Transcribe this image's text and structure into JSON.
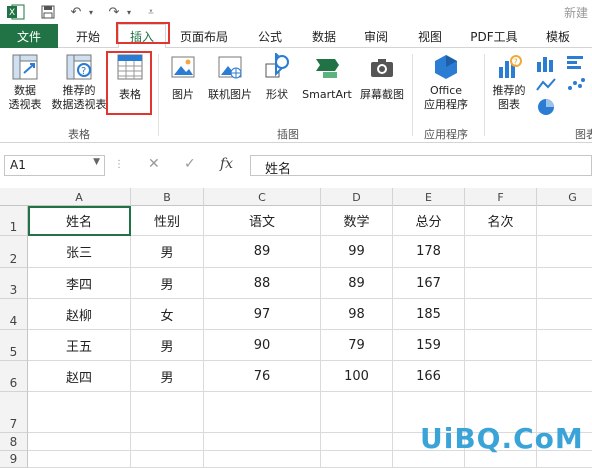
{
  "app": {
    "title_fragment": "新建"
  },
  "tabs": [
    "文件",
    "开始",
    "插入",
    "页面布局",
    "公式",
    "数据",
    "审阅",
    "视图",
    "PDF工具",
    "模板"
  ],
  "ribbon": {
    "buttons": [
      {
        "label1": "数据",
        "label2": "透视表"
      },
      {
        "label1": "推荐的",
        "label2": "数据透视表"
      },
      {
        "label1": "表格",
        "label2": ""
      },
      {
        "label1": "图片",
        "label2": ""
      },
      {
        "label1": "联机图片",
        "label2": ""
      },
      {
        "label1": "形状",
        "label2": ""
      },
      {
        "label1": "SmartArt",
        "label2": ""
      },
      {
        "label1": "屏幕截图",
        "label2": ""
      },
      {
        "label1": "Office",
        "label2": "应用程序"
      },
      {
        "label1": "推荐的",
        "label2": "图表"
      }
    ],
    "groups": [
      "表格",
      "插图",
      "应用程序",
      "图表"
    ]
  },
  "formula": {
    "namebox": "A1",
    "fx": "fx",
    "content": "姓名"
  },
  "columns": [
    "A",
    "B",
    "C",
    "D",
    "E",
    "F",
    "G"
  ],
  "rows": [
    "1",
    "2",
    "3",
    "4",
    "5",
    "6",
    "7",
    "8",
    "9"
  ],
  "table": {
    "headers": [
      "姓名",
      "性别",
      "语文",
      "数学",
      "总分",
      "名次"
    ],
    "rows": [
      [
        "张三",
        "男",
        "89",
        "99",
        "178",
        ""
      ],
      [
        "李四",
        "男",
        "88",
        "89",
        "167",
        ""
      ],
      [
        "赵柳",
        "女",
        "97",
        "98",
        "185",
        ""
      ],
      [
        "王五",
        "男",
        "90",
        "79",
        "159",
        ""
      ],
      [
        "赵四",
        "男",
        "76",
        "100",
        "166",
        ""
      ]
    ]
  },
  "watermark": "UiBQ.CoM",
  "colors": {
    "excel_green": "#217346",
    "highlight_red": "#e0362f",
    "watermark_blue": "#3aa3d8"
  }
}
